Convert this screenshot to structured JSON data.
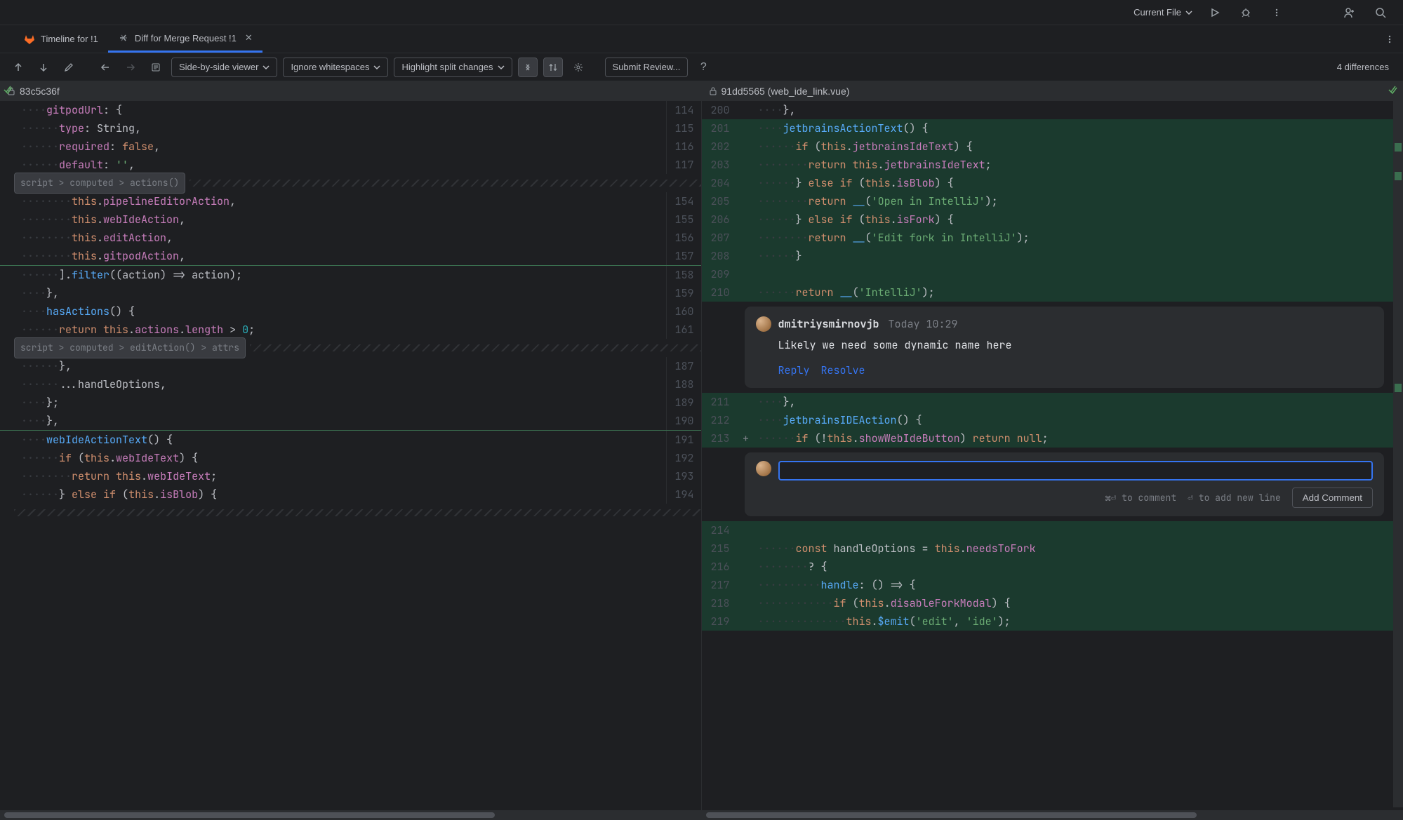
{
  "top": {
    "scope": "Current File",
    "run_icon": "run-icon",
    "debug_icon": "debug-icon",
    "more_icon": "more-vert-icon",
    "new_icon": "new-tab-icon",
    "search_icon": "search-icon"
  },
  "tabs": [
    {
      "id": "tab-timeline",
      "icon": "gitlab-icon",
      "label": "Timeline for !1",
      "active": false,
      "closable": false
    },
    {
      "id": "tab-diff",
      "icon": "diff-icon",
      "label": "Diff for Merge Request !1",
      "active": true,
      "closable": true
    }
  ],
  "diff_toolbar": {
    "viewer_dropdown": "Side-by-side viewer",
    "whitespace_dropdown": "Ignore whitespaces",
    "highlight_dropdown": "Highlight split changes",
    "submit_label": "Submit Review...",
    "diff_count": "4 differences"
  },
  "left": {
    "revision": "83c5c36f",
    "fold1": "script > computed > actions()",
    "fold2": "script > computed > editAction() > attrs",
    "lines": {
      "l114": {
        "n": "114",
        "html": "<span class='dots'>····</span><span class='tk-prop'>gitpodUrl</span><span class='tk-punct'>: {</span>"
      },
      "l_type": {
        "n": "115",
        "html": "<span class='dots'>······</span><span class='tk-prop'>type</span><span class='tk-punct'>: </span><span class='tk-ident'>String</span><span class='tk-punct'>,</span>"
      },
      "l_required": {
        "n": "116",
        "html": "<span class='dots'>······</span><span class='tk-prop'>required</span><span class='tk-punct'>: </span><span class='tk-kw'>false</span><span class='tk-punct'>,</span>"
      },
      "l_default": {
        "n": "117",
        "html": "<span class='dots'>······</span><span class='tk-prop'>default</span><span class='tk-punct'>: </span><span class='tk-str'>''</span><span class='tk-punct'>,</span>"
      },
      "l154": {
        "n": "154",
        "html": "<span class='dots'>········</span><span class='tk-this'>this</span><span class='tk-punct'>.</span><span class='tk-prop'>pipelineEditorAction</span><span class='tk-punct'>,</span>"
      },
      "l155": {
        "n": "155",
        "html": "<span class='dots'>········</span><span class='tk-this'>this</span><span class='tk-punct'>.</span><span class='tk-prop'>webIdeAction</span><span class='tk-punct'>,</span>"
      },
      "l156": {
        "n": "156",
        "html": "<span class='dots'>········</span><span class='tk-this'>this</span><span class='tk-punct'>.</span><span class='tk-prop'>editAction</span><span class='tk-punct'>,</span>"
      },
      "l157": {
        "n": "157",
        "html": "<span class='dots'>········</span><span class='tk-this'>this</span><span class='tk-punct'>.</span><span class='tk-prop'>gitpodAction</span><span class='tk-punct'>,</span>"
      },
      "l158": {
        "n": "158",
        "html": "<span class='dots'>······</span><span class='tk-punct'>].</span><span class='tk-fn'>filter</span><span class='tk-punct'>((</span><span class='tk-ident'>action</span><span class='tk-punct'>) =&gt; action);</span>"
      },
      "l159": {
        "n": "159",
        "html": "<span class='dots'>····</span><span class='tk-punct'>},</span>"
      },
      "l160": {
        "n": "160",
        "html": "<span class='dots'>····</span><span class='tk-fn'>hasActions</span><span class='tk-punct'>() {</span>"
      },
      "l161": {
        "n": "161",
        "html": "<span class='dots'>······</span><span class='tk-kw'>return </span><span class='tk-this'>this</span><span class='tk-punct'>.</span><span class='tk-prop'>actions</span><span class='tk-punct'>.</span><span class='tk-prop'>length</span><span class='tk-punct'> &gt; </span><span class='tk-num'>0</span><span class='tk-punct'>;</span>"
      },
      "l187": {
        "n": "187",
        "html": "<span class='dots'>······</span><span class='tk-punct'>},</span>"
      },
      "l188": {
        "n": "188",
        "html": "<span class='dots'>······</span><span class='tk-punct'>...</span><span class='tk-ident'>handleOptions</span><span class='tk-punct'>,</span>"
      },
      "l189": {
        "n": "189",
        "html": "<span class='dots'>····</span><span class='tk-punct'>};</span>"
      },
      "l190": {
        "n": "190",
        "html": "<span class='dots'>····</span><span class='tk-punct'>},</span>"
      },
      "l191": {
        "n": "191",
        "html": "<span class='dots'>····</span><span class='tk-fn'>webIdeActionText</span><span class='tk-punct'>() {</span>"
      },
      "l192": {
        "n": "192",
        "html": "<span class='dots'>······</span><span class='tk-kw'>if </span><span class='tk-punct'>(</span><span class='tk-this'>this</span><span class='tk-punct'>.</span><span class='tk-prop'>webIdeText</span><span class='tk-punct'>) {</span>"
      },
      "l193": {
        "n": "193",
        "html": "<span class='dots'>········</span><span class='tk-kw'>return </span><span class='tk-this'>this</span><span class='tk-punct'>.</span><span class='tk-prop'>webIdeText</span><span class='tk-punct'>;</span>"
      },
      "l194": {
        "n": "194",
        "html": "<span class='dots'>······</span><span class='tk-punct'>} </span><span class='tk-kw'>else if </span><span class='tk-punct'>(</span><span class='tk-this'>this</span><span class='tk-punct'>.</span><span class='tk-prop'>isBlob</span><span class='tk-punct'>) {</span>"
      }
    }
  },
  "right": {
    "revision": "91dd5565 (web_ide_link.vue)",
    "lines": {
      "r200": {
        "n": "200",
        "html": "<span class='dots'>····</span><span class='tk-punct'>},</span>"
      },
      "r201": {
        "n": "201",
        "html": "<span class='dots'>····</span><span class='tk-fn'>jetbrainsActionText</span><span class='tk-punct'>() {</span>"
      },
      "r202": {
        "n": "202",
        "html": "<span class='dots'>······</span><span class='tk-kw'>if </span><span class='tk-punct'>(</span><span class='tk-this'>this</span><span class='tk-punct'>.</span><span class='tk-prop'>jetbrainsIdeText</span><span class='tk-punct'>) {</span>"
      },
      "r203": {
        "n": "203",
        "html": "<span class='dots'>········</span><span class='tk-kw'>return </span><span class='tk-this'>this</span><span class='tk-punct'>.</span><span class='tk-prop'>jetbrainsIdeText</span><span class='tk-punct'>;</span>"
      },
      "r204": {
        "n": "204",
        "html": "<span class='dots'>······</span><span class='tk-punct'>} </span><span class='tk-kw'>else if </span><span class='tk-punct'>(</span><span class='tk-this'>this</span><span class='tk-punct'>.</span><span class='tk-prop'>isBlob</span><span class='tk-punct'>) {</span>"
      },
      "r205": {
        "n": "205",
        "html": "<span class='dots'>········</span><span class='tk-kw'>return </span><span class='tk-fn'>__</span><span class='tk-punct'>(</span><span class='tk-str'>'Open in IntelliJ'</span><span class='tk-punct'>);</span>"
      },
      "r206": {
        "n": "206",
        "html": "<span class='dots'>······</span><span class='tk-punct'>} </span><span class='tk-kw'>else if </span><span class='tk-punct'>(</span><span class='tk-this'>this</span><span class='tk-punct'>.</span><span class='tk-prop'>isFork</span><span class='tk-punct'>) {</span>"
      },
      "r207": {
        "n": "207",
        "html": "<span class='dots'>········</span><span class='tk-kw'>return </span><span class='tk-fn'>__</span><span class='tk-punct'>(</span><span class='tk-str'>'Edit fork in IntelliJ'</span><span class='tk-punct'>);</span>"
      },
      "r208": {
        "n": "208",
        "html": "<span class='dots'>······</span><span class='tk-punct'>}</span>"
      },
      "r209": {
        "n": "209",
        "html": ""
      },
      "r210": {
        "n": "210",
        "html": "<span class='dots'>······</span><span class='tk-kw'>return </span><span class='tk-fn'>__</span><span class='tk-punct'>(</span><span class='tk-str'>'IntelliJ'</span><span class='tk-punct'>);</span>"
      },
      "r211": {
        "n": "211",
        "html": "<span class='dots'>····</span><span class='tk-punct'>},</span>"
      },
      "r212": {
        "n": "212",
        "html": "<span class='dots'>····</span><span class='tk-fn'>jetbrainsIDEAction</span><span class='tk-punct'>() {</span>"
      },
      "r213": {
        "n": "213",
        "html": "<span class='dots'>······</span><span class='tk-kw'>if </span><span class='tk-punct'>(!</span><span class='tk-this'>this</span><span class='tk-punct'>.</span><span class='tk-prop'>showWebIdeButton</span><span class='tk-punct'>) </span><span class='tk-kw'>return null</span><span class='tk-punct'>;</span>"
      },
      "r214": {
        "n": "214",
        "html": ""
      },
      "r215": {
        "n": "215",
        "html": "<span class='dots'>······</span><span class='tk-kw'>const </span><span class='tk-ident'>handleOptions</span><span class='tk-punct'> = </span><span class='tk-this'>this</span><span class='tk-punct'>.</span><span class='tk-prop'>needsToFork</span>"
      },
      "r216": {
        "n": "216",
        "html": "<span class='dots'>········</span><span class='tk-punct'>? {</span>"
      },
      "r217": {
        "n": "217",
        "html": "<span class='dots'>··········</span><span class='tk-fn'>handle</span><span class='tk-punct'>: () =&gt; {</span>"
      },
      "r218": {
        "n": "218",
        "html": "<span class='dots'>············</span><span class='tk-kw'>if </span><span class='tk-punct'>(</span><span class='tk-this'>this</span><span class='tk-punct'>.</span><span class='tk-prop'>disableForkModal</span><span class='tk-punct'>) {</span>"
      },
      "r219": {
        "n": "219",
        "html": "<span class='dots'>··············</span><span class='tk-this'>this</span><span class='tk-punct'>.</span><span class='tk-fn'>$emit</span><span class='tk-punct'>(</span><span class='tk-str'>'edit'</span><span class='tk-punct'>, </span><span class='tk-str'>'ide'</span><span class='tk-punct'>);</span>"
      }
    }
  },
  "comment": {
    "author": "dmitriysmirnovjb",
    "time": "Today 10:29",
    "body": "Likely we need some dynamic name here",
    "reply_label": "Reply",
    "resolve_label": "Resolve"
  },
  "new_comment": {
    "hint_comment": "⌘⏎ to comment",
    "hint_newline": "⏎ to add new line",
    "add_button": "Add Comment"
  }
}
